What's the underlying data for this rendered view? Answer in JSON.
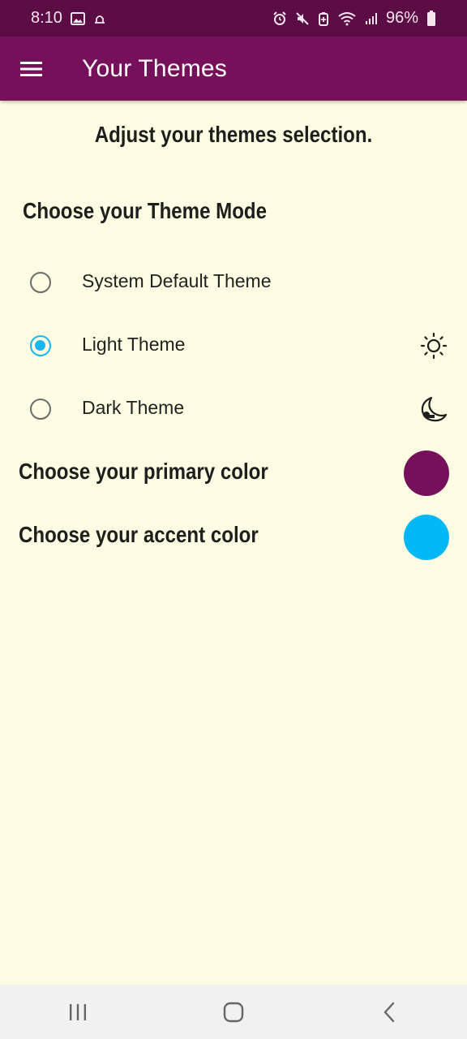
{
  "status_bar": {
    "time": "8:10",
    "battery": "96%",
    "icons_left": [
      "image-icon",
      "notification-icon"
    ],
    "icons_right": [
      "alarm-icon",
      "mute-icon",
      "battery-saver-icon",
      "wifi-icon",
      "signal-icon",
      "battery-icon"
    ]
  },
  "app_bar": {
    "title": "Your Themes",
    "menu_icon": "hamburger-menu-icon"
  },
  "main": {
    "subtitle": "Adjust your themes selection.",
    "theme_mode_title": "Choose your Theme Mode",
    "theme_options": [
      {
        "label": "System Default Theme",
        "selected": false,
        "icon": ""
      },
      {
        "label": "Light Theme",
        "selected": true,
        "icon": "sun-icon"
      },
      {
        "label": "Dark Theme",
        "selected": false,
        "icon": "moon-icon"
      }
    ],
    "primary_color_label": "Choose your primary color",
    "primary_color": "#76105a",
    "accent_color_label": "Choose your accent color",
    "accent_color": "#00b8f5"
  },
  "nav_bar": {
    "buttons": [
      "recent-apps-icon",
      "home-icon",
      "back-icon"
    ]
  },
  "colors": {
    "status_bar": "#5c0c44",
    "app_bar": "#76105a",
    "background": "#fefce2",
    "radio_selected": "#1ab6f0"
  }
}
